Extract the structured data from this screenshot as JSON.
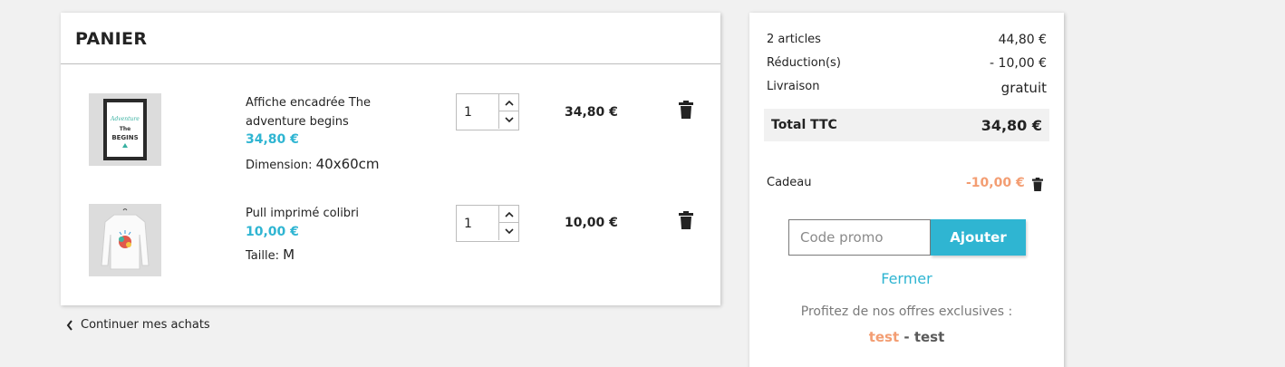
{
  "cart": {
    "title": "PANIER",
    "items": [
      {
        "name_line1": "Affiche encadrée The",
        "name_line2": "adventure begins",
        "price": "34,80 €",
        "attr_label": "Dimension:",
        "attr_value": "40x60cm",
        "quantity": "1",
        "total": "34,80 €",
        "image_text": [
          "The",
          "Adventure",
          "BEGINS"
        ]
      },
      {
        "name_line1": "Pull imprimé colibri",
        "price": "10,00 €",
        "attr_label": "Taille:",
        "attr_value": "M",
        "quantity": "1",
        "total": "10,00 €"
      }
    ],
    "continue_label": "Continuer mes achats"
  },
  "summary": {
    "articles_label": "2 articles",
    "articles_value": "44,80 €",
    "reduction_label": "Réduction(s)",
    "reduction_value": "- 10,00 €",
    "shipping_label": "Livraison",
    "shipping_value": "gratuit",
    "total_label": "Total TTC",
    "total_value": "34,80 €",
    "gift_label": "Cadeau",
    "gift_value": "-10,00 €",
    "promo_placeholder": "Code promo",
    "promo_button": "Ajouter",
    "close_label": "Fermer",
    "offers_text": "Profitez de nos offres exclusives :",
    "offer_code": "test",
    "offer_separator": " - ",
    "offer_name": "test"
  },
  "colors": {
    "accent": "#2fb5d2",
    "discount": "#f39d72",
    "background": "#f1f1f1"
  },
  "icons": [
    "trash-icon",
    "chevron-up-icon",
    "chevron-down-icon",
    "chevron-left-icon"
  ]
}
